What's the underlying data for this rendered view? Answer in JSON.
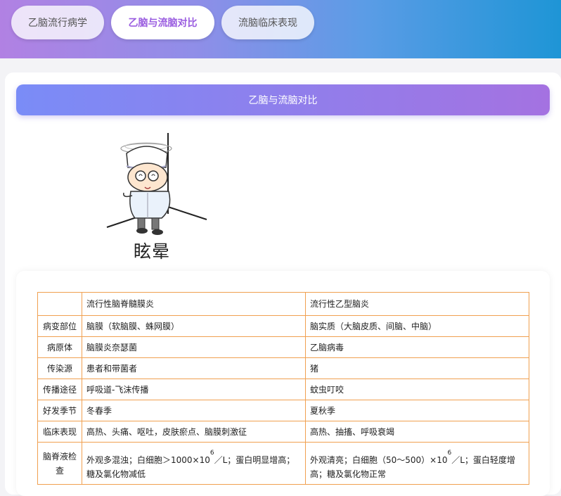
{
  "tabs": [
    {
      "label": "乙脑流行病学",
      "active": false
    },
    {
      "label": "乙脑与流脑对比",
      "active": true
    },
    {
      "label": "流脑临床表现",
      "active": false
    }
  ],
  "section": {
    "title": "乙脑与流脑对比"
  },
  "illustration": {
    "caption": "眩晕"
  },
  "comparison": {
    "header": [
      "",
      "流行性脑脊髓膜炎",
      "流行性乙型脑炎"
    ],
    "rows": [
      [
        "病变部位",
        "脑膜（软脑膜、蛛网膜）",
        "脑实质（大脑皮质、间脑、中脑）"
      ],
      [
        "病原体",
        "脑膜炎奈瑟菌",
        "乙脑病毒"
      ],
      [
        "传染源",
        "患者和带菌者",
        "猪"
      ],
      [
        "传播途径",
        "呼吸道-飞沫传播",
        "蚊虫叮咬"
      ],
      [
        "好发季节",
        "冬春季",
        "夏秋季"
      ],
      [
        "临床表现",
        "高热、头痛、呕吐，皮肤瘀点、脑膜刺激征",
        "高热、抽搐、呼吸衰竭"
      ]
    ],
    "csf": {
      "label": "脑脊液检查",
      "col1_pre": "外观多混浊；白细胞＞1000×10",
      "col1_exp": "6",
      "col1_post": "／L；蛋白明显增高；糖及氯化物减低",
      "col2_pre": "外观清亮；白细胞（50～500）×10",
      "col2_exp": "6",
      "col2_post": "／L；蛋白轻度增高；糖及氯化物正常"
    }
  },
  "colors": {
    "accent": "#9a5de0",
    "table_border": "#f0a050",
    "header_gradient_start": "#7a8cf7",
    "header_gradient_end": "#a472e1"
  }
}
